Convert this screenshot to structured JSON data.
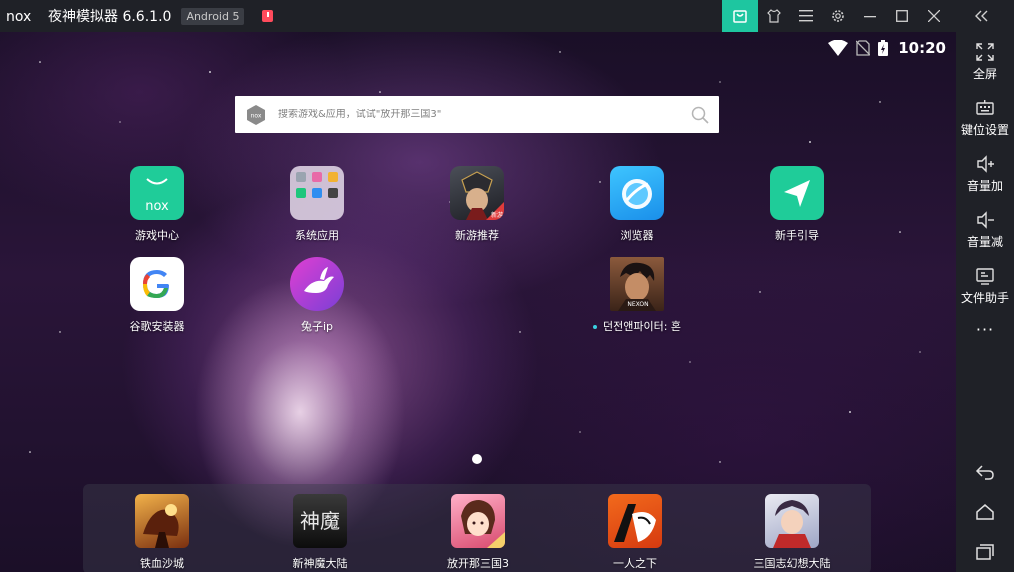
{
  "titlebar": {
    "logo_text": "nox",
    "app_title": "夜神模拟器 6.6.1.0",
    "android_badge": "Android 5",
    "icons": [
      "alert-icon",
      "shop-icon",
      "shirt-icon",
      "menu-icon",
      "gear-icon",
      "minimize-icon",
      "maximize-icon",
      "close-icon",
      "collapse-icon"
    ]
  },
  "sidebar": {
    "items": [
      {
        "label": "全屏",
        "icon": "fullscreen-icon"
      },
      {
        "label": "键位设置",
        "icon": "keyboard-icon"
      },
      {
        "label": "音量加",
        "icon": "volume-up-icon"
      },
      {
        "label": "音量减",
        "icon": "volume-down-icon"
      },
      {
        "label": "文件助手",
        "icon": "file-helper-icon"
      }
    ],
    "more": "···",
    "nav": [
      "back-icon",
      "home-icon",
      "recents-icon"
    ]
  },
  "statusbar": {
    "time": "10:20"
  },
  "search": {
    "placeholder": "搜索游戏&应用，试试\"放开那三国3\""
  },
  "desktop_apps": [
    {
      "label": "游戏中心",
      "icon": "game-center-icon"
    },
    {
      "label": "系统应用",
      "icon": "system-apps-folder-icon"
    },
    {
      "label": "新游推荐",
      "icon": "new-games-icon"
    },
    {
      "label": "浏览器",
      "icon": "browser-icon"
    },
    {
      "label": "新手引导",
      "icon": "guide-icon"
    },
    {
      "label": "谷歌安装器",
      "icon": "google-installer-icon"
    },
    {
      "label": "兔子ip",
      "icon": "rabbit-ip-icon"
    },
    {
      "label": "던전앤파이터: 혼",
      "icon": "dnf-icon"
    }
  ],
  "dock_apps": [
    {
      "label": "铁血沙城",
      "icon": "tiexue-shacheng-icon"
    },
    {
      "label": "新神魔大陆",
      "icon": "shenmo-dalu-icon"
    },
    {
      "label": "放开那三国3",
      "icon": "fangkai-sanguo-icon"
    },
    {
      "label": "一人之下",
      "icon": "yiren-zhixia-icon"
    },
    {
      "label": "三国志幻想大陆",
      "icon": "sanguozhi-icon"
    }
  ],
  "colors": {
    "titlebar_bg": "#1f2127",
    "accent": "#1ec6a0",
    "alert": "#ff4b5c"
  },
  "icon_text": {
    "dnf_brand": "NEXON",
    "shenmo_text": "神魔",
    "new_badge": "新游"
  }
}
